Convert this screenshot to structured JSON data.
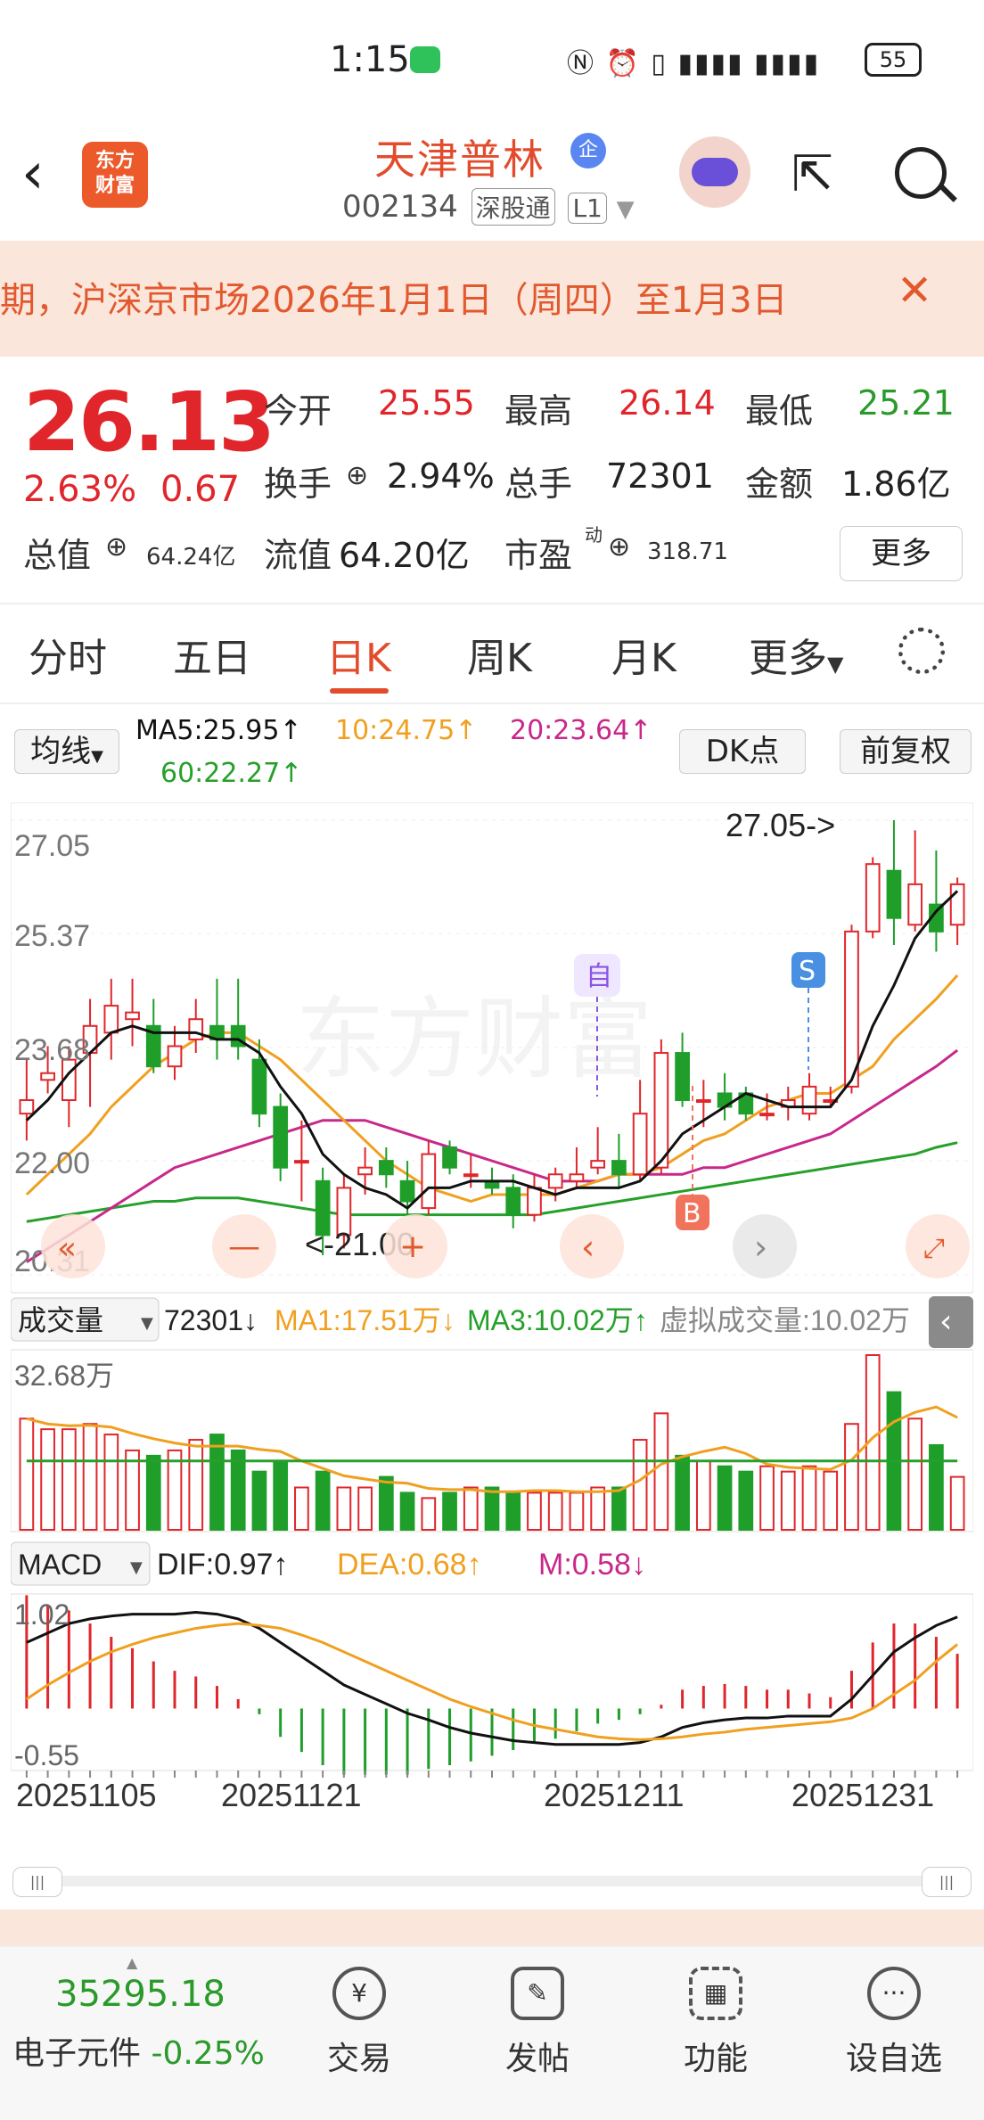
{
  "status_bar": {
    "time": "1:15",
    "battery": "55",
    "signal_icons": [
      "nfc-icon",
      "alarm-icon",
      "vibrate-icon",
      "signal-4g-icon",
      "signal-4g-icon"
    ]
  },
  "header": {
    "logo_line1": "东方",
    "logo_line2": "财富",
    "stock_name": "天津普林",
    "stock_badge": "企",
    "stock_code": "002134",
    "exchange_tag": "深股通",
    "level_tag": "L1"
  },
  "notice": {
    "text": "期，沪深京市场2026年1月1日（周四）至1月3日"
  },
  "quote": {
    "price": "26.13",
    "change_pct": "2.63%",
    "change": "0.67",
    "open_label": "今开",
    "open": "25.55",
    "high_label": "最高",
    "high": "26.14",
    "low_label": "最低",
    "low": "25.21",
    "turnover_label": "换手",
    "turnover": "2.94%",
    "volume_label": "总手",
    "volume": "72301",
    "amount_label": "金额",
    "amount": "1.86亿",
    "mktcap_label": "总值",
    "mktcap": "64.24亿",
    "float_label": "流值",
    "float": "64.20亿",
    "pe_label": "市盈",
    "pe_sup": "动",
    "pe": "318.71",
    "more_label": "更多"
  },
  "tabs": [
    {
      "label": "分时"
    },
    {
      "label": "五日"
    },
    {
      "label": "日K"
    },
    {
      "label": "周K"
    },
    {
      "label": "月K"
    },
    {
      "label": "更多"
    }
  ],
  "ma_bar": {
    "selector": "均线",
    "ma5": "MA5:25.95↑",
    "ma10": "10:24.75↑",
    "ma20": "20:23.64↑",
    "ma60": "60:22.27↑",
    "dk_label": "DK点",
    "fq_label": "前复权"
  },
  "kline": {
    "y_ticks": [
      "27.05",
      "25.37",
      "23.68",
      "22.00",
      "20.31"
    ],
    "max_label": "27.05->",
    "min_label": "<-21.00",
    "marker_self": "自",
    "marker_s": "S",
    "marker_b": "B",
    "watermark": "东方财富"
  },
  "volume_bar": {
    "selector": "成交量",
    "value": "72301↓",
    "ma1": "MA1:17.51万↓",
    "ma3": "MA3:10.02万↑",
    "virtual": "虚拟成交量:10.02万",
    "top_label": "32.68万"
  },
  "macd_bar": {
    "selector": "MACD",
    "dif": "DIF:0.97↑",
    "dea": "DEA:0.68↑",
    "m": "M:0.58↓",
    "top_label": "1.02",
    "bottom_label": "-0.55"
  },
  "x_labels": [
    "20251105",
    "20251121",
    "20251211",
    "20251231"
  ],
  "colors": {
    "up": "#e0262b",
    "down": "#1f9e2a",
    "ma5": "#111111",
    "ma10": "#f0a020",
    "ma20": "#c8288a",
    "ma60": "#26a02a",
    "accent": "#e24c2d"
  },
  "chart_data": {
    "type": "candlestick",
    "candles": [
      {
        "o": 22.7,
        "c": 22.9,
        "h": 23.5,
        "l": 22.3
      },
      {
        "o": 23.2,
        "c": 23.3,
        "h": 23.7,
        "l": 23.0
      },
      {
        "o": 22.9,
        "c": 23.5,
        "h": 23.7,
        "l": 22.5
      },
      {
        "o": 23.6,
        "c": 24.0,
        "h": 24.4,
        "l": 22.8
      },
      {
        "o": 23.9,
        "c": 24.3,
        "h": 24.7,
        "l": 23.5
      },
      {
        "o": 24.1,
        "c": 24.2,
        "h": 24.7,
        "l": 23.7
      },
      {
        "o": 24.0,
        "c": 23.4,
        "h": 24.4,
        "l": 23.3
      },
      {
        "o": 23.4,
        "c": 23.7,
        "h": 24.0,
        "l": 23.2
      },
      {
        "o": 23.8,
        "c": 24.1,
        "h": 24.4,
        "l": 23.6
      },
      {
        "o": 24.0,
        "c": 23.8,
        "h": 24.7,
        "l": 23.5
      },
      {
        "o": 24.0,
        "c": 23.7,
        "h": 24.7,
        "l": 23.5
      },
      {
        "o": 23.5,
        "c": 22.7,
        "h": 23.8,
        "l": 22.5
      },
      {
        "o": 22.8,
        "c": 21.9,
        "h": 23.0,
        "l": 21.7
      },
      {
        "o": 22.0,
        "c": 22.0,
        "h": 22.6,
        "l": 21.4
      },
      {
        "o": 21.7,
        "c": 20.9,
        "h": 21.9,
        "l": 20.6
      },
      {
        "o": 20.9,
        "c": 21.6,
        "h": 21.8,
        "l": 20.7
      },
      {
        "o": 21.8,
        "c": 21.9,
        "h": 22.2,
        "l": 21.5
      },
      {
        "o": 22.0,
        "c": 21.8,
        "h": 22.2,
        "l": 21.6
      },
      {
        "o": 21.7,
        "c": 21.4,
        "h": 22.0,
        "l": 21.2
      },
      {
        "o": 21.3,
        "c": 22.1,
        "h": 22.3,
        "l": 21.2
      },
      {
        "o": 22.2,
        "c": 21.9,
        "h": 22.3,
        "l": 21.8
      },
      {
        "o": 21.8,
        "c": 21.8,
        "h": 22.1,
        "l": 21.6
      },
      {
        "o": 21.7,
        "c": 21.6,
        "h": 21.9,
        "l": 21.5
      },
      {
        "o": 21.6,
        "c": 21.2,
        "h": 21.8,
        "l": 21.0
      },
      {
        "o": 21.2,
        "c": 21.6,
        "h": 21.8,
        "l": 21.1
      },
      {
        "o": 21.6,
        "c": 21.8,
        "h": 21.9,
        "l": 21.4
      },
      {
        "o": 21.7,
        "c": 21.8,
        "h": 22.2,
        "l": 21.6
      },
      {
        "o": 21.9,
        "c": 22.0,
        "h": 22.5,
        "l": 21.8
      },
      {
        "o": 22.0,
        "c": 21.8,
        "h": 22.4,
        "l": 21.6
      },
      {
        "o": 21.8,
        "c": 22.7,
        "h": 23.2,
        "l": 21.7
      },
      {
        "o": 21.9,
        "c": 23.6,
        "h": 23.8,
        "l": 21.8
      },
      {
        "o": 23.6,
        "c": 22.9,
        "h": 23.9,
        "l": 22.8
      },
      {
        "o": 22.9,
        "c": 22.9,
        "h": 23.2,
        "l": 22.5
      },
      {
        "o": 23.0,
        "c": 22.8,
        "h": 23.3,
        "l": 22.6
      },
      {
        "o": 23.0,
        "c": 22.7,
        "h": 23.1,
        "l": 22.6
      },
      {
        "o": 22.7,
        "c": 22.7,
        "h": 23.0,
        "l": 22.6
      },
      {
        "o": 22.8,
        "c": 22.9,
        "h": 23.1,
        "l": 22.6
      },
      {
        "o": 22.7,
        "c": 23.1,
        "h": 23.3,
        "l": 22.6
      },
      {
        "o": 22.9,
        "c": 22.9,
        "h": 23.1,
        "l": 22.8
      },
      {
        "o": 23.1,
        "c": 25.4,
        "h": 25.5,
        "l": 23.0
      },
      {
        "o": 25.4,
        "c": 26.4,
        "h": 26.5,
        "l": 25.3
      },
      {
        "o": 26.3,
        "c": 25.6,
        "h": 27.05,
        "l": 25.2
      },
      {
        "o": 25.5,
        "c": 26.1,
        "h": 26.9,
        "l": 25.4
      },
      {
        "o": 25.8,
        "c": 25.4,
        "h": 26.6,
        "l": 25.1
      },
      {
        "o": 25.5,
        "c": 26.1,
        "h": 26.2,
        "l": 25.2
      }
    ],
    "ma5": [
      22.6,
      22.9,
      23.3,
      23.6,
      23.9,
      24.0,
      23.9,
      23.9,
      23.9,
      23.8,
      23.8,
      23.6,
      23.1,
      22.7,
      22.1,
      21.8,
      21.6,
      21.5,
      21.3,
      21.6,
      21.6,
      21.7,
      21.7,
      21.7,
      21.6,
      21.5,
      21.6,
      21.6,
      21.6,
      21.7,
      22.0,
      22.4,
      22.6,
      22.8,
      23.0,
      22.9,
      22.8,
      22.8,
      22.8,
      23.2,
      24.0,
      24.6,
      25.3,
      25.7,
      26.0
    ],
    "ma10": [
      21.5,
      21.8,
      22.1,
      22.4,
      22.8,
      23.1,
      23.4,
      23.6,
      23.8,
      23.9,
      23.9,
      23.7,
      23.5,
      23.2,
      22.9,
      22.6,
      22.3,
      22.0,
      21.8,
      21.6,
      21.5,
      21.4,
      21.5,
      21.5,
      21.5,
      21.5,
      21.6,
      21.7,
      21.8,
      21.8,
      21.9,
      22.1,
      22.3,
      22.4,
      22.6,
      22.8,
      22.9,
      23.0,
      23.0,
      23.2,
      23.4,
      23.8,
      24.1,
      24.4,
      24.75
    ],
    "ma20": [
      20.5,
      20.7,
      20.9,
      21.1,
      21.3,
      21.5,
      21.7,
      21.9,
      22.0,
      22.1,
      22.2,
      22.3,
      22.4,
      22.5,
      22.6,
      22.6,
      22.6,
      22.5,
      22.4,
      22.3,
      22.2,
      22.1,
      22.0,
      21.9,
      21.8,
      21.7,
      21.7,
      21.7,
      21.8,
      21.8,
      21.8,
      21.8,
      21.9,
      21.9,
      22.0,
      22.1,
      22.2,
      22.3,
      22.4,
      22.6,
      22.8,
      23.0,
      23.2,
      23.4,
      23.64
    ],
    "ma60": [
      21.1,
      21.15,
      21.2,
      21.25,
      21.3,
      21.35,
      21.4,
      21.4,
      21.45,
      21.45,
      21.45,
      21.4,
      21.35,
      21.3,
      21.25,
      21.2,
      21.2,
      21.2,
      21.2,
      21.2,
      21.2,
      21.2,
      21.2,
      21.2,
      21.2,
      21.25,
      21.3,
      21.35,
      21.4,
      21.45,
      21.5,
      21.55,
      21.6,
      21.65,
      21.7,
      21.75,
      21.8,
      21.85,
      21.9,
      21.95,
      22.0,
      22.05,
      22.1,
      22.2,
      22.27
    ],
    "volume": [
      21,
      19,
      19,
      20,
      18,
      15,
      14,
      15,
      17,
      18,
      15,
      11,
      13,
      8,
      11,
      8,
      8,
      10,
      7,
      6,
      7,
      8,
      8,
      7,
      7,
      7,
      7,
      8,
      8,
      17,
      22,
      14,
      13,
      12,
      11,
      12,
      11,
      12,
      11,
      20,
      33,
      26,
      21,
      16,
      10
    ],
    "macd_dif": [
      0.7,
      0.8,
      0.9,
      0.95,
      0.98,
      1.0,
      1.0,
      1.0,
      1.02,
      1.0,
      0.95,
      0.85,
      0.7,
      0.55,
      0.4,
      0.25,
      0.15,
      0.05,
      -0.05,
      -0.12,
      -0.2,
      -0.26,
      -0.3,
      -0.34,
      -0.36,
      -0.38,
      -0.38,
      -0.38,
      -0.38,
      -0.36,
      -0.3,
      -0.2,
      -0.15,
      -0.12,
      -0.1,
      -0.1,
      -0.08,
      -0.08,
      -0.08,
      0.1,
      0.35,
      0.6,
      0.75,
      0.88,
      0.97
    ],
    "macd_dea": [
      0.1,
      0.25,
      0.38,
      0.5,
      0.6,
      0.68,
      0.75,
      0.8,
      0.85,
      0.88,
      0.9,
      0.88,
      0.85,
      0.78,
      0.7,
      0.6,
      0.5,
      0.4,
      0.3,
      0.2,
      0.1,
      0.02,
      -0.05,
      -0.12,
      -0.18,
      -0.22,
      -0.26,
      -0.3,
      -0.32,
      -0.33,
      -0.32,
      -0.3,
      -0.27,
      -0.25,
      -0.22,
      -0.2,
      -0.18,
      -0.16,
      -0.14,
      -0.1,
      0.0,
      0.15,
      0.3,
      0.5,
      0.68
    ],
    "ylim": [
      20.31,
      27.05
    ]
  }
}
